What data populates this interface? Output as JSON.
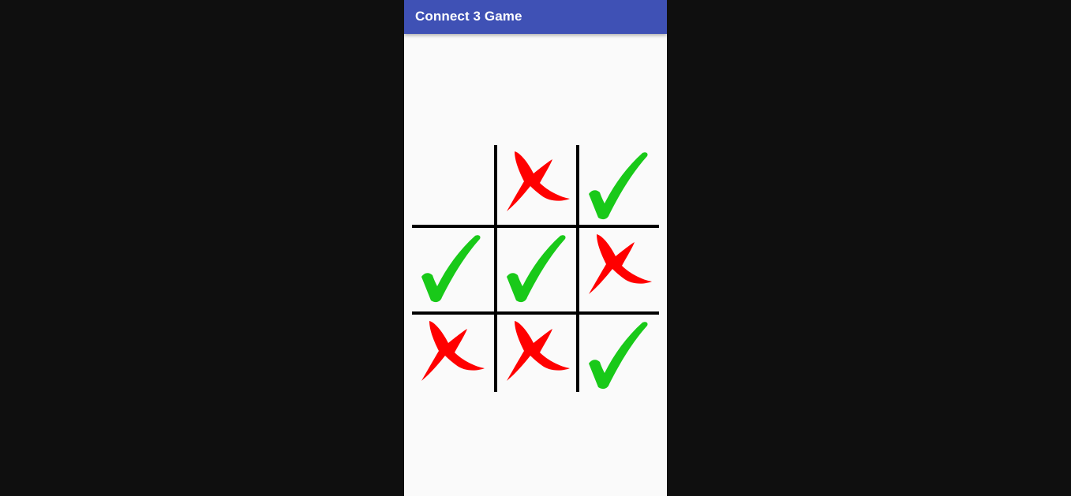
{
  "app_bar": {
    "title": "Connect 3 Game",
    "background_color": "#3f51b5"
  },
  "board": {
    "rows": [
      [
        "empty",
        "red-x",
        "green-check"
      ],
      [
        "green-check",
        "green-check",
        "red-x"
      ],
      [
        "red-x",
        "red-x",
        "green-check"
      ]
    ],
    "legend": {
      "red-x": "red-x-icon",
      "green-check": "green-check-icon",
      "empty": "empty"
    },
    "colors": {
      "red_x": "#ff0000",
      "green_check": "#19c919",
      "grid": "#000000"
    }
  }
}
